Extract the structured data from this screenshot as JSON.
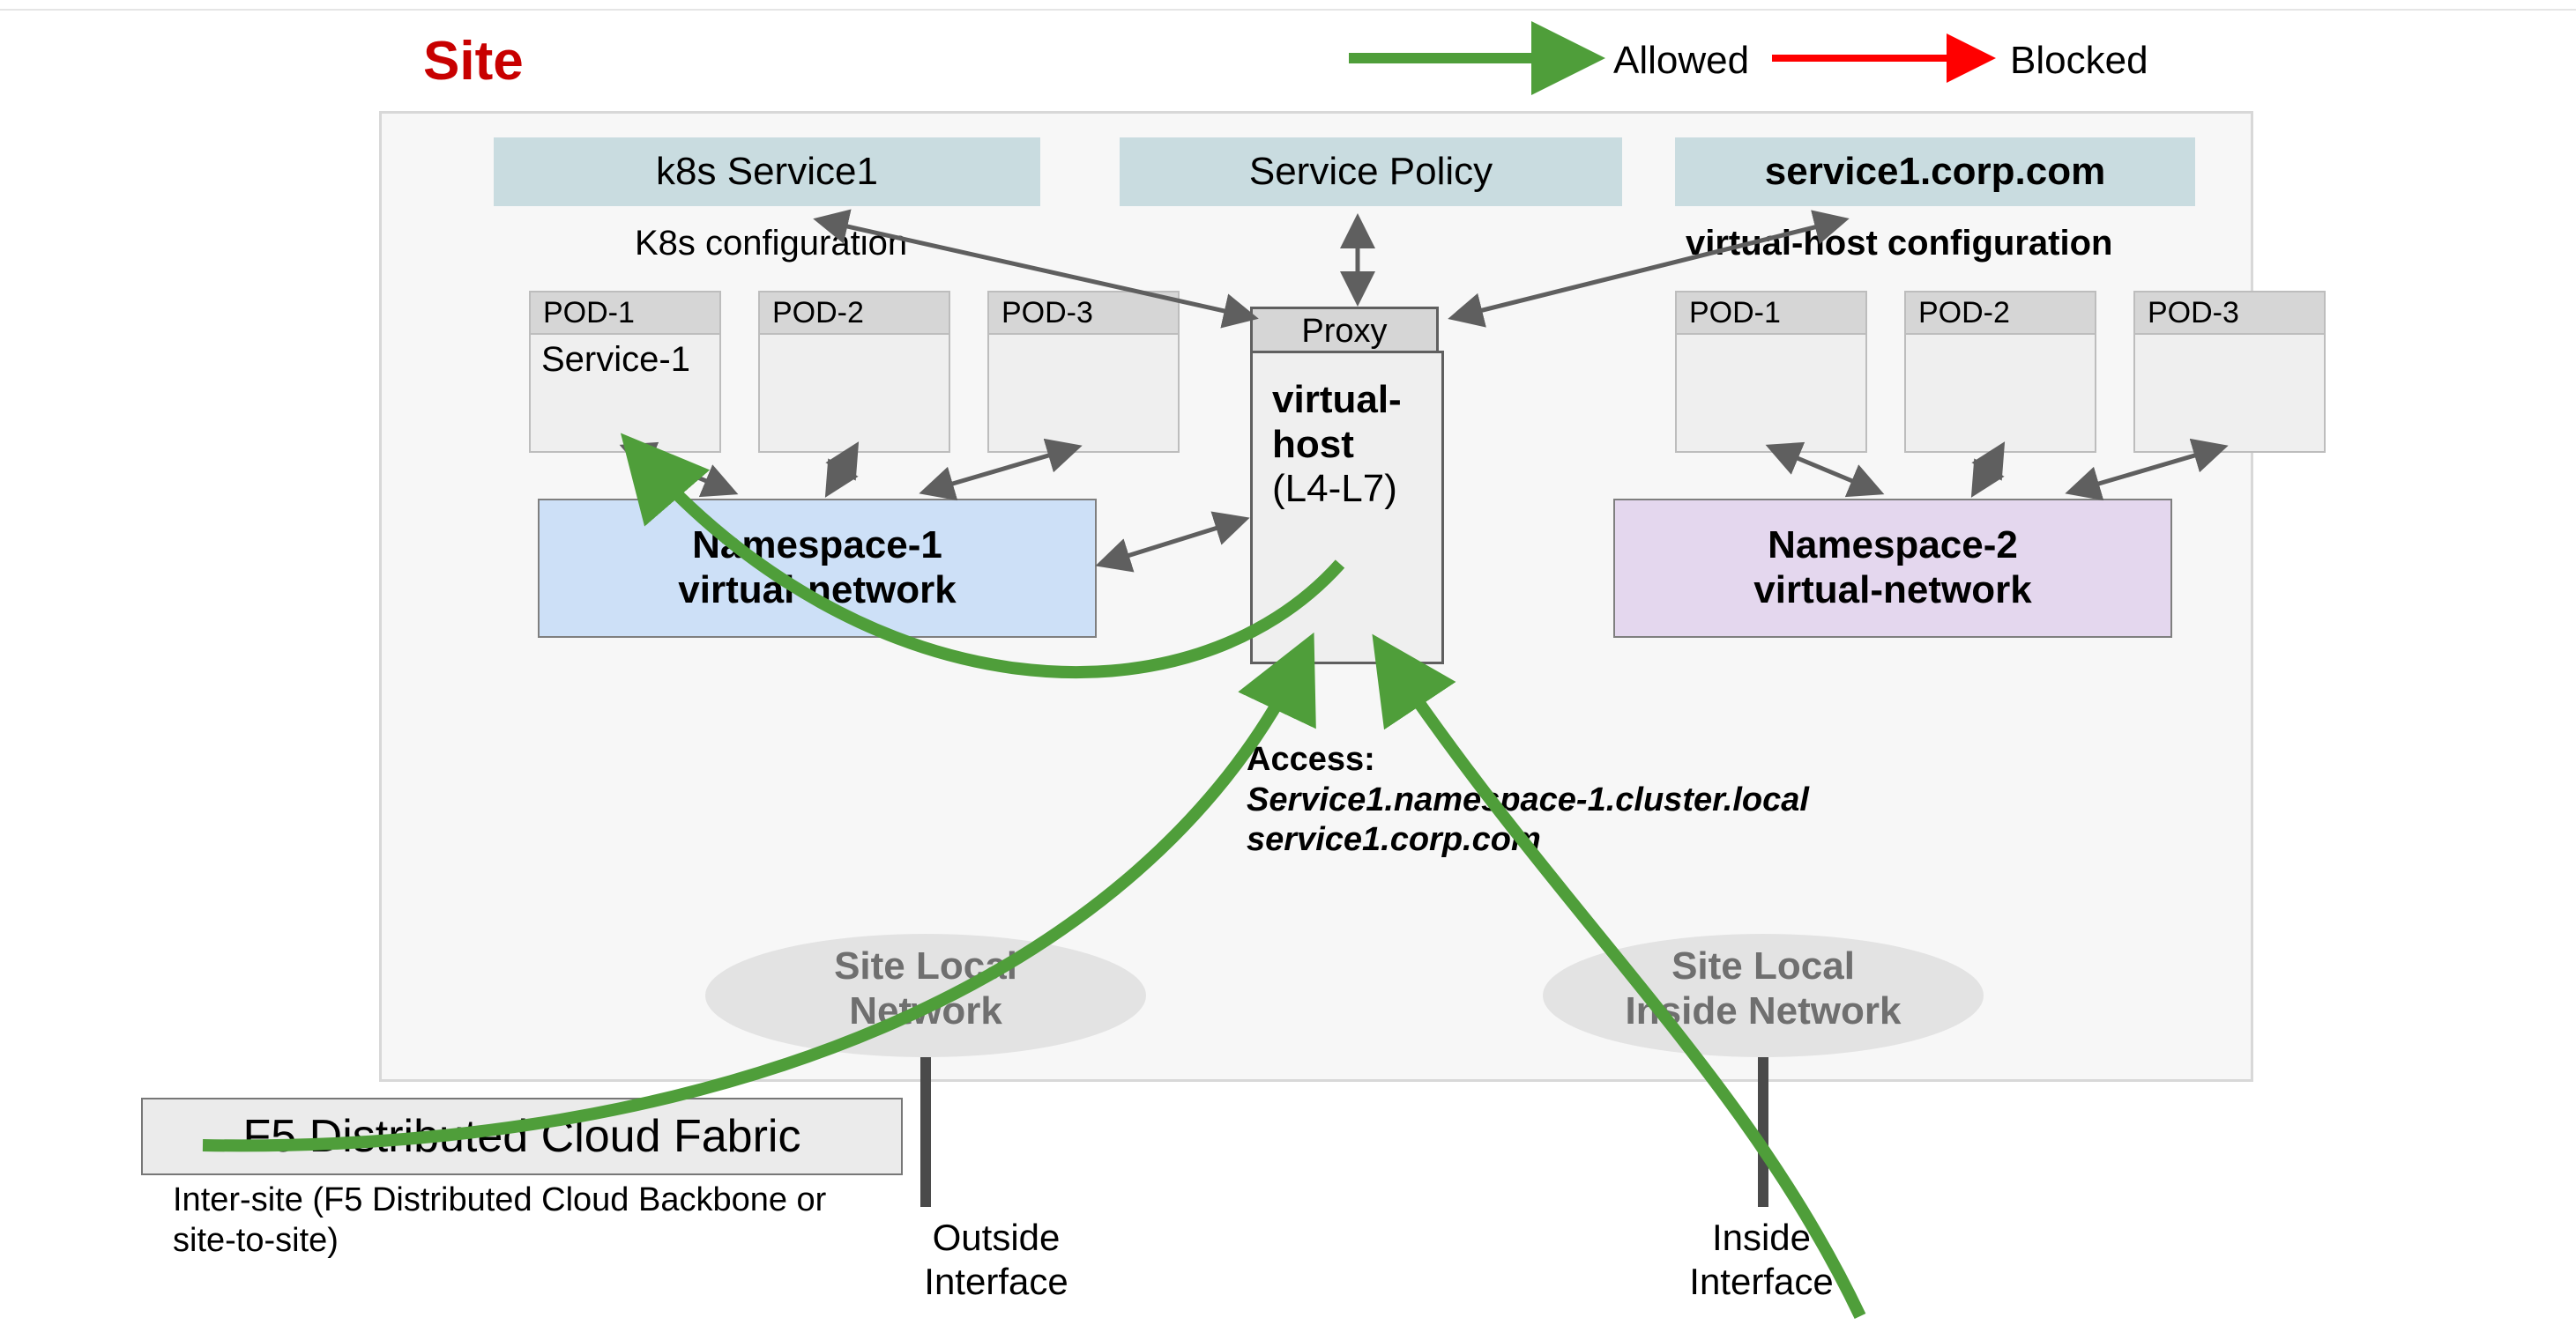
{
  "title": "Site",
  "legend": {
    "allowed": "Allowed",
    "blocked": "Blocked",
    "allowed_color": "#4f9e3a",
    "blocked_color": "#ff0000"
  },
  "top_cards": {
    "k8s_service": "k8s Service1",
    "service_policy": "Service Policy",
    "service_domain": "service1.corp.com"
  },
  "sub_captions": {
    "left": "K8s configuration",
    "right": "virtual-host configuration"
  },
  "left_pods": [
    {
      "header": "POD-1",
      "body": "Service-1"
    },
    {
      "header": "POD-2",
      "body": ""
    },
    {
      "header": "POD-3",
      "body": ""
    }
  ],
  "right_pods": [
    {
      "header": "POD-1",
      "body": ""
    },
    {
      "header": "POD-2",
      "body": ""
    },
    {
      "header": "POD-3",
      "body": ""
    }
  ],
  "namespaces": {
    "ns1_title": "Namespace-1",
    "ns1_sub": "virtual-network",
    "ns2_title": "Namespace-2",
    "ns2_sub": "virtual-network"
  },
  "proxy": {
    "header": "Proxy",
    "line1": "virtual-",
    "line2": "host",
    "line3": "(L4-L7)"
  },
  "access": {
    "title": "Access:",
    "line1": "Service1.namespace-1.cluster.local",
    "line2": "service1.corp.com"
  },
  "ovals": {
    "left_l1": "Site Local",
    "left_l2": "Network",
    "right_l1": "Site Local",
    "right_l2": "Inside Network"
  },
  "fabric": {
    "title": "F5 Distributed Cloud Fabric",
    "caption_l1": "Inter-site (F5 Distributed Cloud Backbone or",
    "caption_l2": "site-to-site)"
  },
  "interfaces": {
    "outside_l1": "Outside",
    "outside_l2": "Interface",
    "inside_l1": "Inside",
    "inside_l2": "Interface"
  }
}
